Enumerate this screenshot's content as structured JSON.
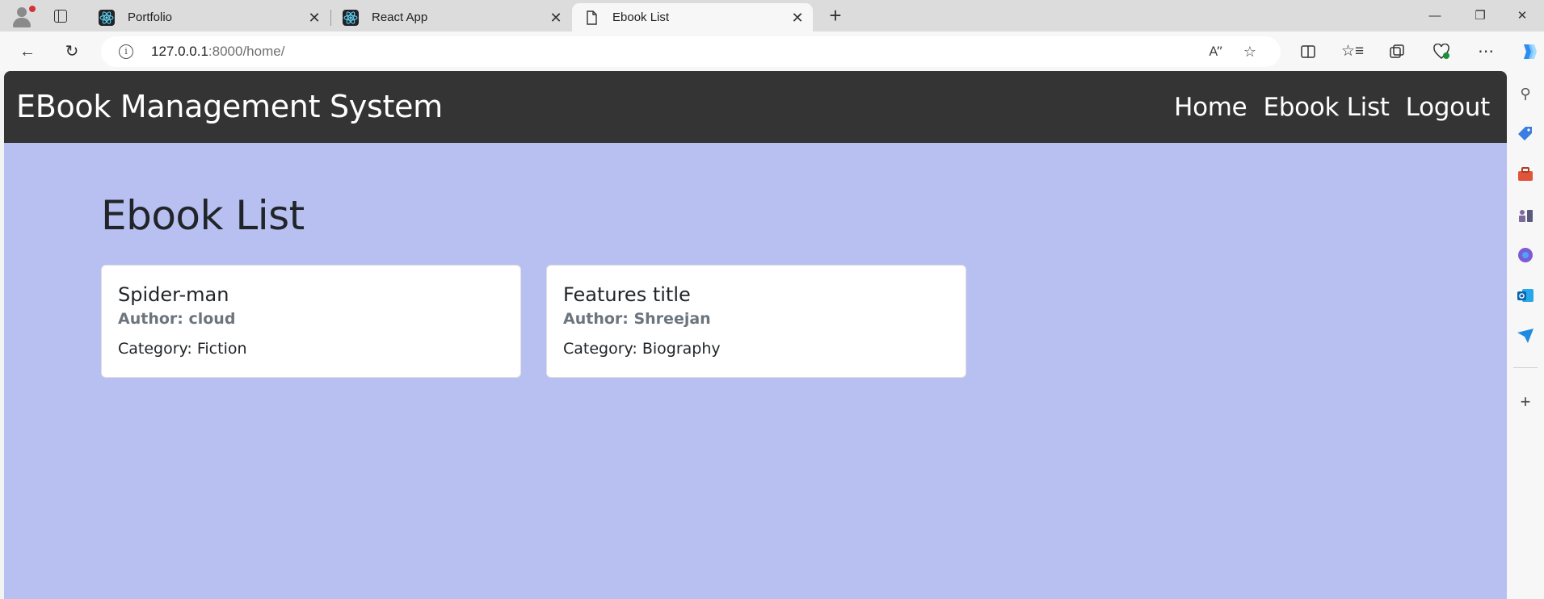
{
  "browser": {
    "tabs": [
      {
        "title": "Portfolio",
        "icon": "react-icon",
        "active": false
      },
      {
        "title": "React App",
        "icon": "react-icon",
        "active": false
      },
      {
        "title": "Ebook List",
        "icon": "page-icon",
        "active": true
      }
    ],
    "address": {
      "host": "127.0.0.1",
      "path": ":8000/home/"
    },
    "window_controls": [
      "minimize",
      "restore",
      "close"
    ],
    "sidebar_icons": [
      "search-icon",
      "tag-icon",
      "toolbox-icon",
      "chess-icon",
      "copilot-apps-icon",
      "outlook-icon",
      "send-icon",
      "add-icon"
    ]
  },
  "site": {
    "brand": "EBook Management System",
    "nav": {
      "home": "Home",
      "ebook_list": "Ebook List",
      "logout": "Logout"
    },
    "heading": "Ebook List",
    "books": [
      {
        "title": "Spider-man",
        "author": "Author: cloud",
        "category": "Category: Fiction"
      },
      {
        "title": "Features title",
        "author": "Author: Shreejan",
        "category": "Category: Biography"
      }
    ]
  },
  "colors": {
    "navbar_bg": "#343434",
    "page_bg": "#b8c0f1",
    "card_bg": "#ffffff"
  }
}
